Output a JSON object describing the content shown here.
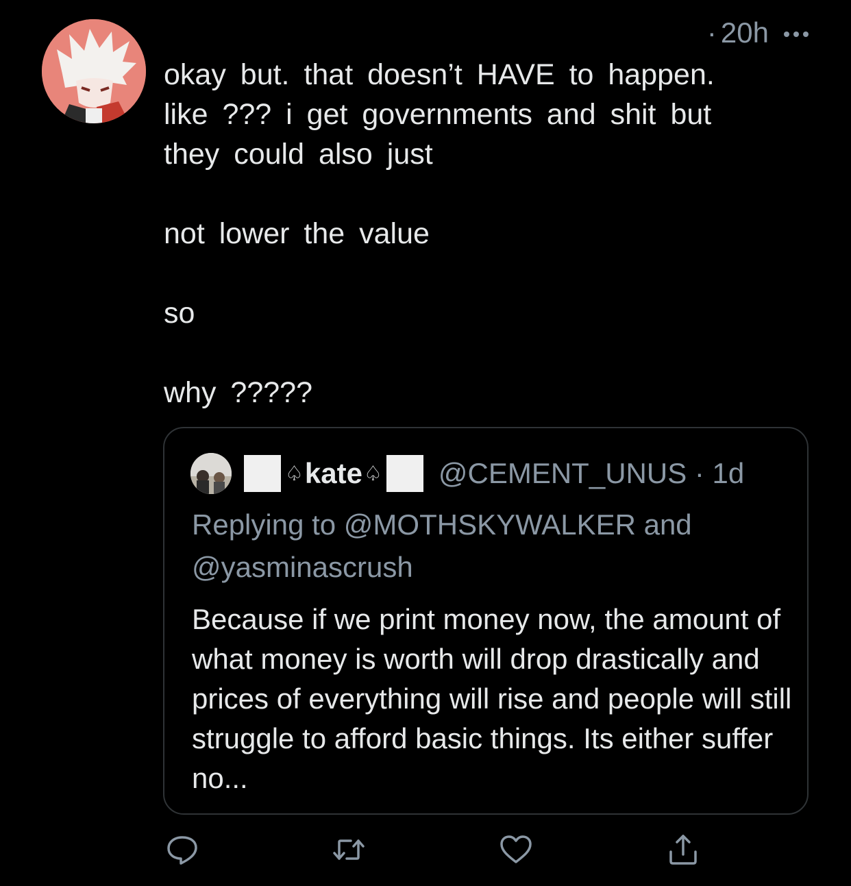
{
  "tweet": {
    "time": "20h",
    "dot": "·",
    "lines": [
      "okay but. that doesn’t HAVE to happen.",
      "like ??? i get governments and shit but",
      "they could also just"
    ],
    "para2": "not lower the value",
    "para3": "so",
    "para4": "why ?????"
  },
  "quote": {
    "name": "kate",
    "spade": "♤",
    "handle": "@CEMENT_UNUS · 1d",
    "replying_to": "Replying to @MOTHSKYWALKER and @yasminascrush",
    "text": "Because if we print money now, the amount of what money is worth will drop drastically and prices of everything will rise and people will still struggle to afford basic things. Its either suffer no..."
  },
  "actions": [
    {
      "icon": "reply-icon"
    },
    {
      "icon": "retweet-icon"
    },
    {
      "icon": "like-icon"
    },
    {
      "icon": "share-icon"
    }
  ],
  "colors": {
    "background": "#000000",
    "text": "#e7e9ea",
    "secondary": "#8b98a5",
    "border": "#2f3336",
    "avatar": "#e8857a"
  }
}
